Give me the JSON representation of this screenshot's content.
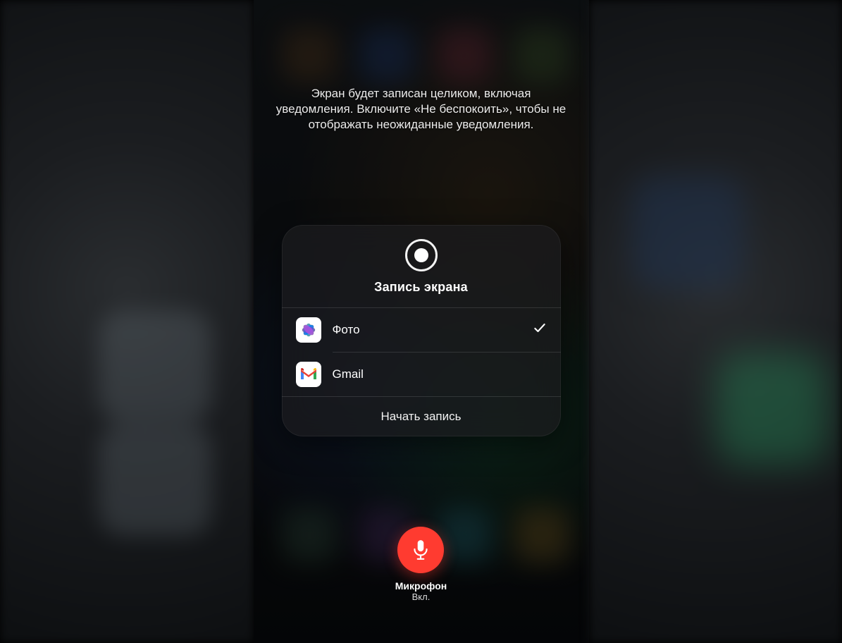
{
  "info_text": "Экран будет записан целиком, включая уведомления. Включите «Не беспокоить», чтобы не отображать неожиданные уведомления.",
  "panel": {
    "title": "Запись экрана",
    "apps": [
      {
        "label": "Фото",
        "selected": true
      },
      {
        "label": "Gmail",
        "selected": false
      }
    ],
    "start_label": "Начать запись"
  },
  "mic": {
    "label": "Микрофон",
    "status": "Вкл."
  },
  "colors": {
    "mic_button": "#ff3b30"
  }
}
